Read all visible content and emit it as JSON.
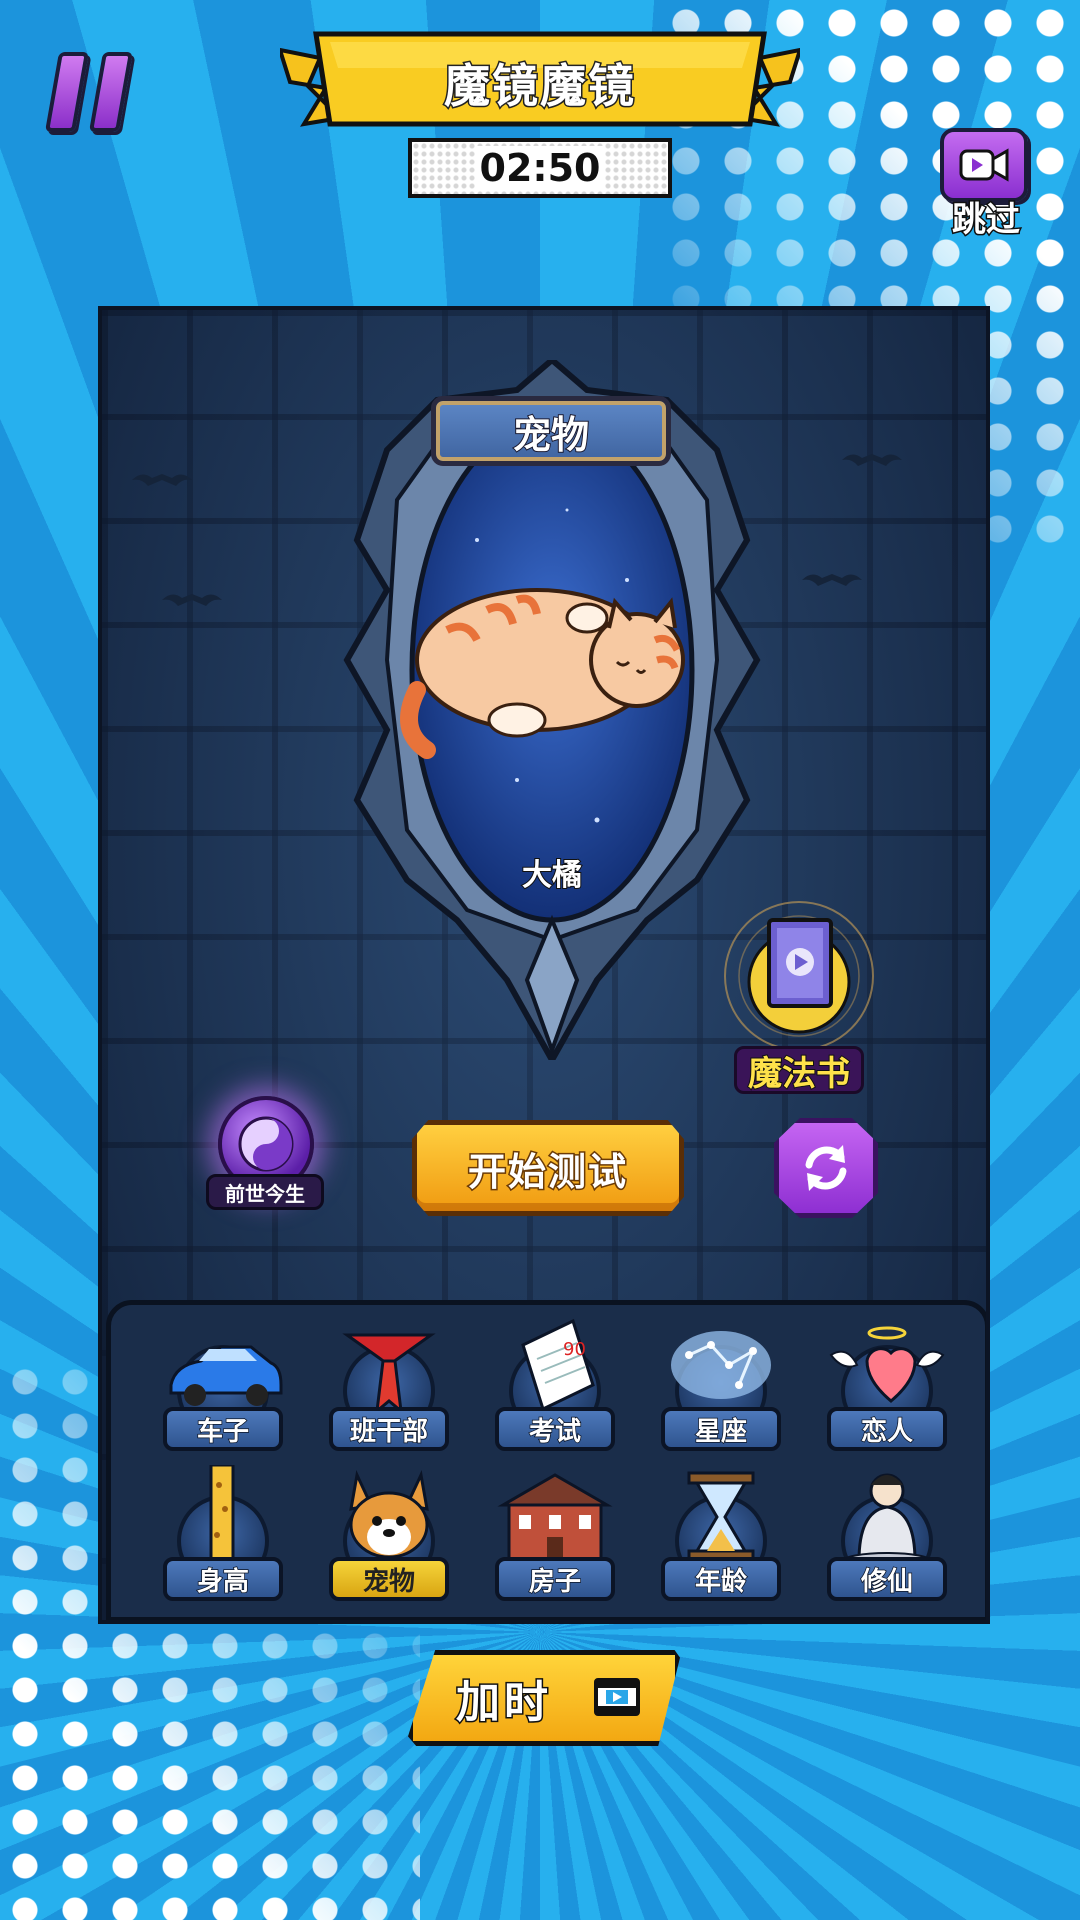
{
  "header": {
    "title": "魔镜魔镜",
    "timer": "02:50",
    "skip_label": "跳过"
  },
  "mirror": {
    "category_label": "宠物",
    "pet_name": "大橘"
  },
  "side": {
    "magic_book_label": "魔法书",
    "past_life_label": "前世今生"
  },
  "actions": {
    "start_label": "开始测试",
    "add_time_label": "加时"
  },
  "categories": [
    {
      "label": "车子",
      "icon": "car-icon"
    },
    {
      "label": "班干部",
      "icon": "red-scarf-icon"
    },
    {
      "label": "考试",
      "icon": "exam-paper-icon"
    },
    {
      "label": "星座",
      "icon": "constellation-icon"
    },
    {
      "label": "恋人",
      "icon": "winged-hearts-icon"
    },
    {
      "label": "身高",
      "icon": "giraffe-icon"
    },
    {
      "label": "宠物",
      "icon": "corgi-icon",
      "selected": true
    },
    {
      "label": "房子",
      "icon": "house-icon"
    },
    {
      "label": "年龄",
      "icon": "hourglass-icon"
    },
    {
      "label": "修仙",
      "icon": "immortal-icon"
    }
  ],
  "colors": {
    "accent_yellow": "#f5c023",
    "accent_purple": "#9a3ad8",
    "panel_blue": "#233e62"
  }
}
